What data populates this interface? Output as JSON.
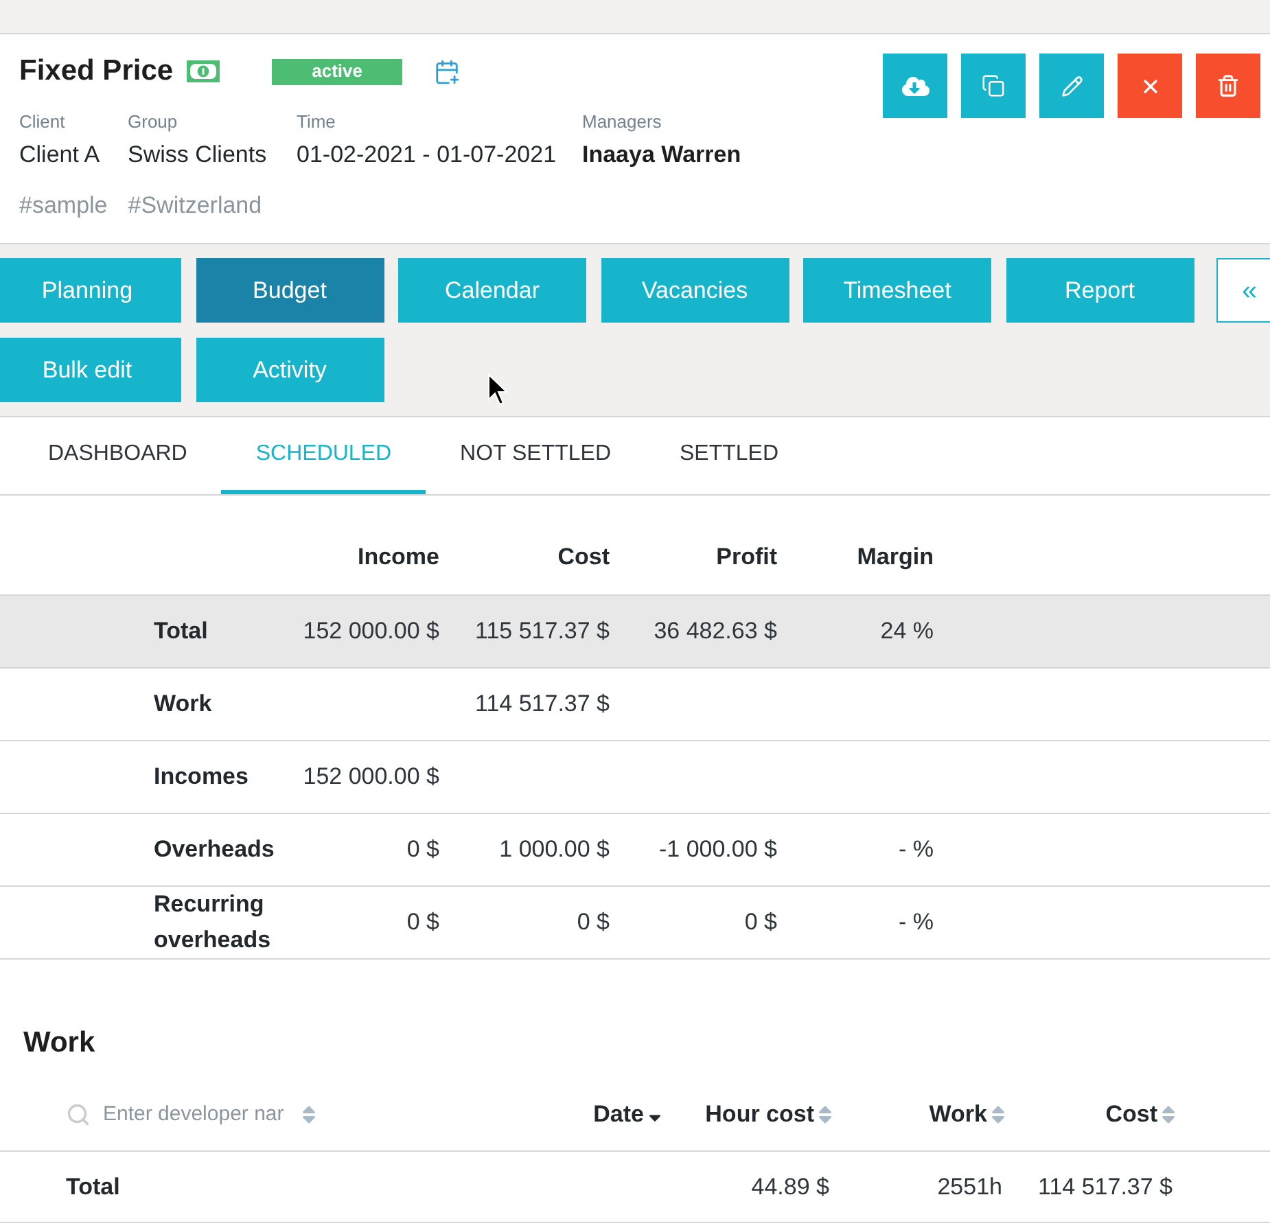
{
  "project": {
    "title": "Fixed Price",
    "status": "active",
    "fields": [
      {
        "label": "Client",
        "value": "Client A",
        "kind": "text"
      },
      {
        "label": "Group",
        "value": "Swiss Clients",
        "kind": "text"
      },
      {
        "label": "Time",
        "value": "01-02-2021 - 01-07-2021",
        "kind": "text"
      },
      {
        "label": "Managers",
        "value": "Inaaya Warren",
        "kind": "person"
      }
    ],
    "tags": [
      "#sample",
      "#Switzerland"
    ]
  },
  "nav": {
    "buttons": [
      {
        "label": "Planning",
        "selected": false
      },
      {
        "label": "Budget",
        "selected": true
      },
      {
        "label": "Calendar",
        "selected": false
      },
      {
        "label": "Vacancies",
        "selected": false
      },
      {
        "label": "Timesheet",
        "selected": false
      },
      {
        "label": "Report",
        "selected": false
      },
      {
        "label": "Bulk edit",
        "selected": false
      },
      {
        "label": "Activity",
        "selected": false
      }
    ],
    "collapse": "«"
  },
  "tabs": [
    {
      "label": "DASHBOARD",
      "selected": false
    },
    {
      "label": "SCHEDULED",
      "selected": true
    },
    {
      "label": "NOT SETTLED",
      "selected": false
    },
    {
      "label": "SETTLED",
      "selected": false
    }
  ],
  "budget": {
    "columns": [
      "Income",
      "Cost",
      "Profit",
      "Margin"
    ],
    "rows": [
      {
        "label": "Total",
        "highlighted": true,
        "cells": [
          "152 000.00 $",
          "115 517.37 $",
          "36 482.63 $",
          "24 %"
        ]
      },
      {
        "label": "Work",
        "highlighted": false,
        "cells": [
          null,
          "114 517.37 $",
          null,
          null
        ]
      },
      {
        "label": "Incomes",
        "highlighted": false,
        "cells": [
          "152 000.00 $",
          null,
          null,
          null
        ]
      },
      {
        "label": "Overheads",
        "highlighted": false,
        "cells": [
          "0 $",
          "1 000.00 $",
          "-1 000.00 $",
          "- %"
        ]
      },
      {
        "label": "Recurring overheads",
        "highlighted": false,
        "cells": [
          "0 $",
          "0 $",
          "0 $",
          "- %"
        ]
      }
    ]
  },
  "work": {
    "title": "Work",
    "name_column": {
      "placeholder": "Enter developer nar",
      "sorted": false
    },
    "columns": [
      {
        "label": "Date",
        "sorted": true
      },
      {
        "label": "Hour cost",
        "sorted": false
      },
      {
        "label": "Work",
        "sorted": false
      },
      {
        "label": "Cost",
        "sorted": false
      }
    ],
    "total": {
      "label": "Total",
      "cells": [
        null,
        "44.89 $",
        "2551h",
        "114 517.37 $"
      ]
    }
  }
}
